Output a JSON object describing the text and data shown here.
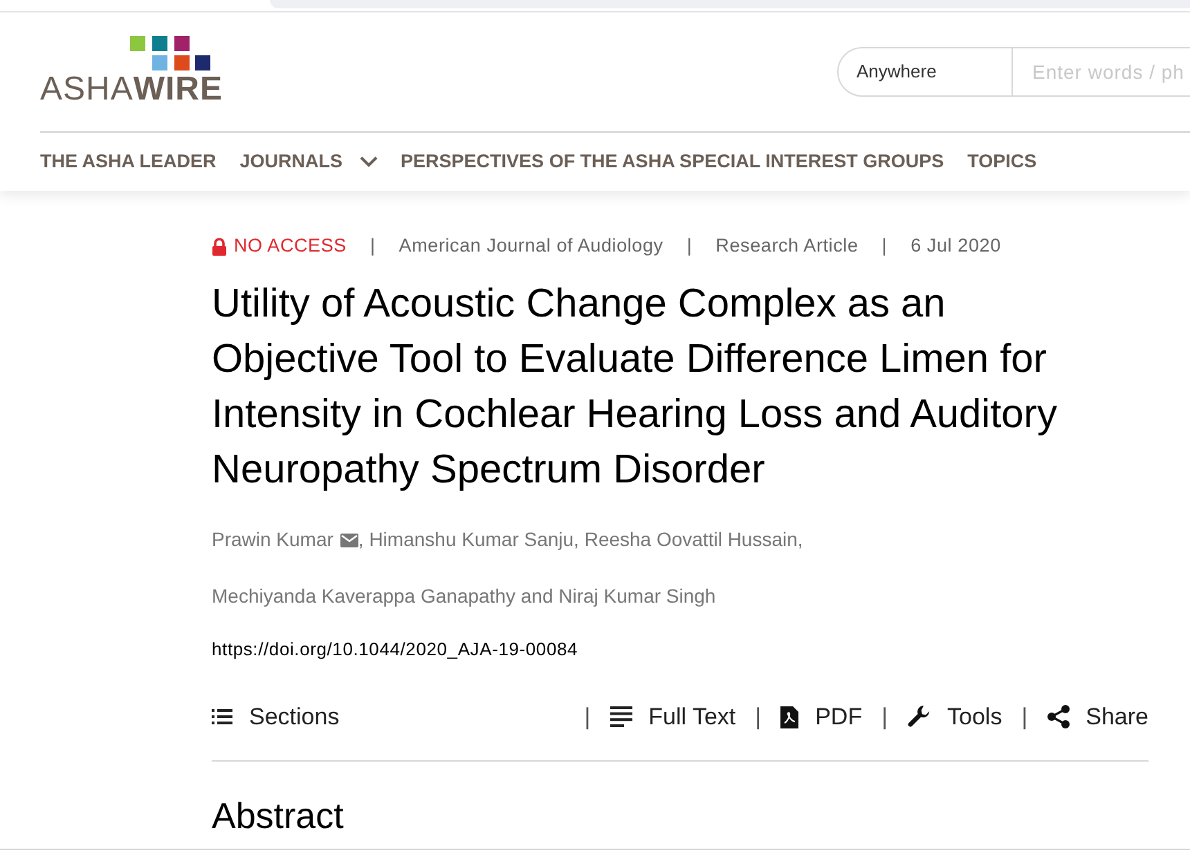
{
  "logo": {
    "text": "ASHA**WIRE**"
  },
  "search": {
    "scope": "Anywhere",
    "placeholder": "Enter words / ph"
  },
  "nav": [
    {
      "label": "THE ASHA LEADER",
      "dropdown": false
    },
    {
      "label": "JOURNALS",
      "dropdown": true
    },
    {
      "label": "PERSPECTIVES OF THE ASHA SPECIAL INTEREST GROUPS",
      "dropdown": false
    },
    {
      "label": "TOPICS",
      "dropdown": false
    }
  ],
  "meta": [
    {
      "kind": "access",
      "text": "NO ACCESS"
    },
    {
      "kind": "separator",
      "text": "|"
    },
    {
      "kind": "journal",
      "text": "American Journal of Audiology"
    },
    {
      "kind": "separator",
      "text": "|"
    },
    {
      "kind": "type",
      "text": "Research Article"
    },
    {
      "kind": "separator",
      "text": "|"
    },
    {
      "kind": "date",
      "text": "6 Jul 2020"
    }
  ],
  "title": "Utility of Acoustic Change Complex as an Objective Tool to Evaluate Difference Limen for Intensity in Cochlear Hearing Loss and Auditory Neuropathy Spectrum Disorder",
  "author_lines": [
    [
      {
        "text": "Prawin Kumar",
        "email": true
      },
      {
        "text": ", Himanshu Kumar Sanju, Reesha Oovattil Hussain,",
        "email": false
      }
    ],
    [
      {
        "text": "Mechiyanda Kaverappa Ganapathy and Niraj Kumar Singh",
        "email": false
      }
    ]
  ],
  "doi": "https://doi.org/10.1044/2020_AJA-19-00084",
  "sections": {
    "label": "Sections"
  },
  "tools": [
    {
      "kind": "separator",
      "text": "|"
    },
    {
      "kind": "fulltext",
      "text": "Full Text"
    },
    {
      "kind": "separator",
      "text": "|"
    },
    {
      "kind": "pdf",
      "text": "PDF"
    },
    {
      "kind": "separator",
      "text": "|"
    },
    {
      "kind": "tools",
      "text": "Tools"
    },
    {
      "kind": "separator",
      "text": "|"
    },
    {
      "kind": "share",
      "text": "Share"
    }
  ],
  "abstract_heading": "Abstract"
}
